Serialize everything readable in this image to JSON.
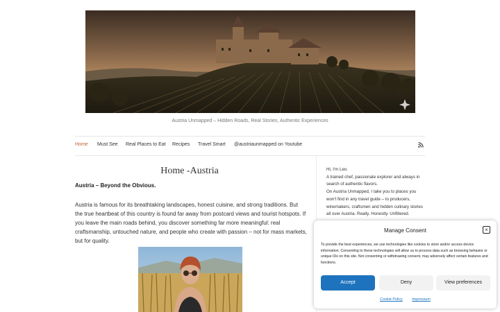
{
  "header": {
    "hero_alt": "Castle on a hill above vineyards at sunset",
    "tagline": "Austria Unmapped – Hidden Roads, Real Stories, Authentic Experiences"
  },
  "nav": {
    "items": [
      {
        "label": "Home",
        "active": true
      },
      {
        "label": "Must See"
      },
      {
        "label": "Real Places to Eat"
      },
      {
        "label": "Recipes"
      },
      {
        "label": "Travel Smart"
      },
      {
        "label": "@austriaunmapped on Youtube"
      }
    ],
    "rss_icon": "rss-icon"
  },
  "main": {
    "page_title": "Home -Austria",
    "subtitle": "Austria – Beyond the Obvious.",
    "intro": "Austria is famous for its breathtaking landscapes, honest cuisine, and strong traditions. But the true heartbeat of this country is found far away from postcard views and tourist hotspots. If you leave the main roads behind, you discover something far more meaningful: real craftsmanship, untouched nature, and people who create with passion – not for mass markets, but for quality.",
    "photo_alt": "Woman in sunglasses and headscarf in a cornfield"
  },
  "sidebar": {
    "greeting": "Hi, I'm Leo.",
    "bio_1": "A trained chef, passionate explorer and always in search of authentic flavors.",
    "bio_2": "On Austria Unmapped, I take you to places you won't find in any travel guide – to producers, winemakers, craftsmen and hidden culinary stories all over Austria. Really. Honestly. Unfiltered."
  },
  "consent": {
    "title": "Manage Consent",
    "text": "To provide the best experiences, we use technologies like cookies to store and/or access device information. Consenting to these technologies will allow us to process data such as browsing behavior or unique IDs on this site. Not consenting or withdrawing consent, may adversely affect certain features and functions.",
    "accept": "Accept",
    "deny": "Deny",
    "preferences": "View preferences",
    "cookie_policy": "Cookie Policy",
    "impressum": "Impressum",
    "close": "×"
  },
  "colors": {
    "accent": "#c0612f",
    "button_primary": "#1e73be"
  }
}
